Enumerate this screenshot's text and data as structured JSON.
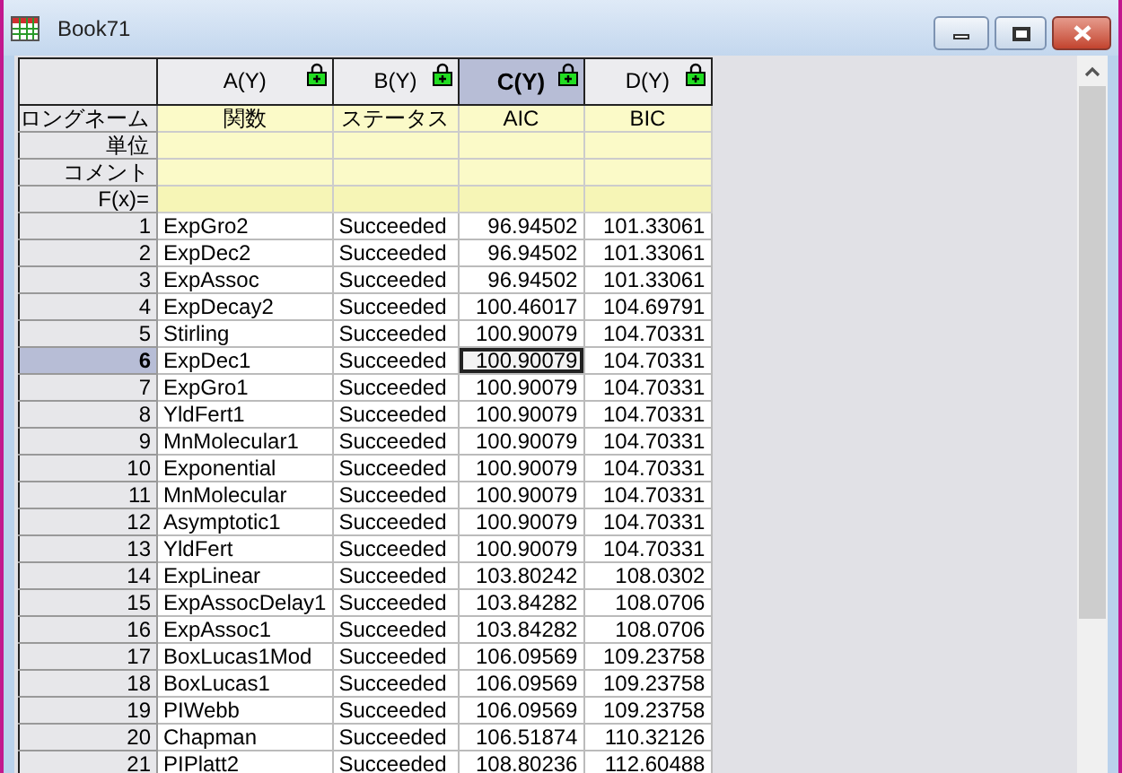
{
  "window": {
    "title": "Book71"
  },
  "columns": [
    {
      "label": "A(Y)",
      "selected": false
    },
    {
      "label": "B(Y)",
      "selected": false
    },
    {
      "label": "C(Y)",
      "selected": true
    },
    {
      "label": "D(Y)",
      "selected": false
    }
  ],
  "label_rows": [
    {
      "label": "ロングネーム",
      "cells": [
        "関数",
        "ステータス",
        "AIC",
        "BIC"
      ]
    },
    {
      "label": "単位",
      "cells": []
    },
    {
      "label": "コメント",
      "cells": []
    },
    {
      "label": "F(x)=",
      "cells": []
    }
  ],
  "rows": [
    {
      "number": "1",
      "selected": false,
      "cells": [
        {
          "text": "ExpGro2",
          "active": false
        },
        {
          "text": "Succeeded",
          "active": false
        },
        {
          "text": "96.94502",
          "active": false
        },
        {
          "text": "101.33061",
          "active": false
        }
      ]
    },
    {
      "number": "2",
      "selected": false,
      "cells": [
        {
          "text": "ExpDec2",
          "active": false
        },
        {
          "text": "Succeeded",
          "active": false
        },
        {
          "text": "96.94502",
          "active": false
        },
        {
          "text": "101.33061",
          "active": false
        }
      ]
    },
    {
      "number": "3",
      "selected": false,
      "cells": [
        {
          "text": "ExpAssoc",
          "active": false
        },
        {
          "text": "Succeeded",
          "active": false
        },
        {
          "text": "96.94502",
          "active": false
        },
        {
          "text": "101.33061",
          "active": false
        }
      ]
    },
    {
      "number": "4",
      "selected": false,
      "cells": [
        {
          "text": "ExpDecay2",
          "active": false
        },
        {
          "text": "Succeeded",
          "active": false
        },
        {
          "text": "100.46017",
          "active": false
        },
        {
          "text": "104.69791",
          "active": false
        }
      ]
    },
    {
      "number": "5",
      "selected": false,
      "cells": [
        {
          "text": "Stirling",
          "active": false
        },
        {
          "text": "Succeeded",
          "active": false
        },
        {
          "text": "100.90079",
          "active": false
        },
        {
          "text": "104.70331",
          "active": false
        }
      ]
    },
    {
      "number": "6",
      "selected": true,
      "cells": [
        {
          "text": "ExpDec1",
          "active": false
        },
        {
          "text": "Succeeded",
          "active": false
        },
        {
          "text": "100.90079",
          "active": true
        },
        {
          "text": "104.70331",
          "active": false
        }
      ]
    },
    {
      "number": "7",
      "selected": false,
      "cells": [
        {
          "text": "ExpGro1",
          "active": false
        },
        {
          "text": "Succeeded",
          "active": false
        },
        {
          "text": "100.90079",
          "active": false
        },
        {
          "text": "104.70331",
          "active": false
        }
      ]
    },
    {
      "number": "8",
      "selected": false,
      "cells": [
        {
          "text": "YldFert1",
          "active": false
        },
        {
          "text": "Succeeded",
          "active": false
        },
        {
          "text": "100.90079",
          "active": false
        },
        {
          "text": "104.70331",
          "active": false
        }
      ]
    },
    {
      "number": "9",
      "selected": false,
      "cells": [
        {
          "text": "MnMolecular1",
          "active": false
        },
        {
          "text": "Succeeded",
          "active": false
        },
        {
          "text": "100.90079",
          "active": false
        },
        {
          "text": "104.70331",
          "active": false
        }
      ]
    },
    {
      "number": "10",
      "selected": false,
      "cells": [
        {
          "text": "Exponential",
          "active": false
        },
        {
          "text": "Succeeded",
          "active": false
        },
        {
          "text": "100.90079",
          "active": false
        },
        {
          "text": "104.70331",
          "active": false
        }
      ]
    },
    {
      "number": "11",
      "selected": false,
      "cells": [
        {
          "text": "MnMolecular",
          "active": false
        },
        {
          "text": "Succeeded",
          "active": false
        },
        {
          "text": "100.90079",
          "active": false
        },
        {
          "text": "104.70331",
          "active": false
        }
      ]
    },
    {
      "number": "12",
      "selected": false,
      "cells": [
        {
          "text": "Asymptotic1",
          "active": false
        },
        {
          "text": "Succeeded",
          "active": false
        },
        {
          "text": "100.90079",
          "active": false
        },
        {
          "text": "104.70331",
          "active": false
        }
      ]
    },
    {
      "number": "13",
      "selected": false,
      "cells": [
        {
          "text": "YldFert",
          "active": false
        },
        {
          "text": "Succeeded",
          "active": false
        },
        {
          "text": "100.90079",
          "active": false
        },
        {
          "text": "104.70331",
          "active": false
        }
      ]
    },
    {
      "number": "14",
      "selected": false,
      "cells": [
        {
          "text": "ExpLinear",
          "active": false
        },
        {
          "text": "Succeeded",
          "active": false
        },
        {
          "text": "103.80242",
          "active": false
        },
        {
          "text": "108.0302",
          "active": false
        }
      ]
    },
    {
      "number": "15",
      "selected": false,
      "cells": [
        {
          "text": "ExpAssocDelay1",
          "active": false
        },
        {
          "text": "Succeeded",
          "active": false
        },
        {
          "text": "103.84282",
          "active": false
        },
        {
          "text": "108.0706",
          "active": false
        }
      ]
    },
    {
      "number": "16",
      "selected": false,
      "cells": [
        {
          "text": "ExpAssoc1",
          "active": false
        },
        {
          "text": "Succeeded",
          "active": false
        },
        {
          "text": "103.84282",
          "active": false
        },
        {
          "text": "108.0706",
          "active": false
        }
      ]
    },
    {
      "number": "17",
      "selected": false,
      "cells": [
        {
          "text": "BoxLucas1Mod",
          "active": false
        },
        {
          "text": "Succeeded",
          "active": false
        },
        {
          "text": "106.09569",
          "active": false
        },
        {
          "text": "109.23758",
          "active": false
        }
      ]
    },
    {
      "number": "18",
      "selected": false,
      "cells": [
        {
          "text": "BoxLucas1",
          "active": false
        },
        {
          "text": "Succeeded",
          "active": false
        },
        {
          "text": "106.09569",
          "active": false
        },
        {
          "text": "109.23758",
          "active": false
        }
      ]
    },
    {
      "number": "19",
      "selected": false,
      "cells": [
        {
          "text": "PIWebb",
          "active": false
        },
        {
          "text": "Succeeded",
          "active": false
        },
        {
          "text": "106.09569",
          "active": false
        },
        {
          "text": "109.23758",
          "active": false
        }
      ]
    },
    {
      "number": "20",
      "selected": false,
      "cells": [
        {
          "text": "Chapman",
          "active": false
        },
        {
          "text": "Succeeded",
          "active": false
        },
        {
          "text": "106.51874",
          "active": false
        },
        {
          "text": "110.32126",
          "active": false
        }
      ]
    },
    {
      "number": "21",
      "selected": false,
      "cells": [
        {
          "text": "PIPlatt2",
          "active": false
        },
        {
          "text": "Succeeded",
          "active": false
        },
        {
          "text": "108.80236",
          "active": false
        },
        {
          "text": "112.60488",
          "active": false
        }
      ]
    }
  ]
}
